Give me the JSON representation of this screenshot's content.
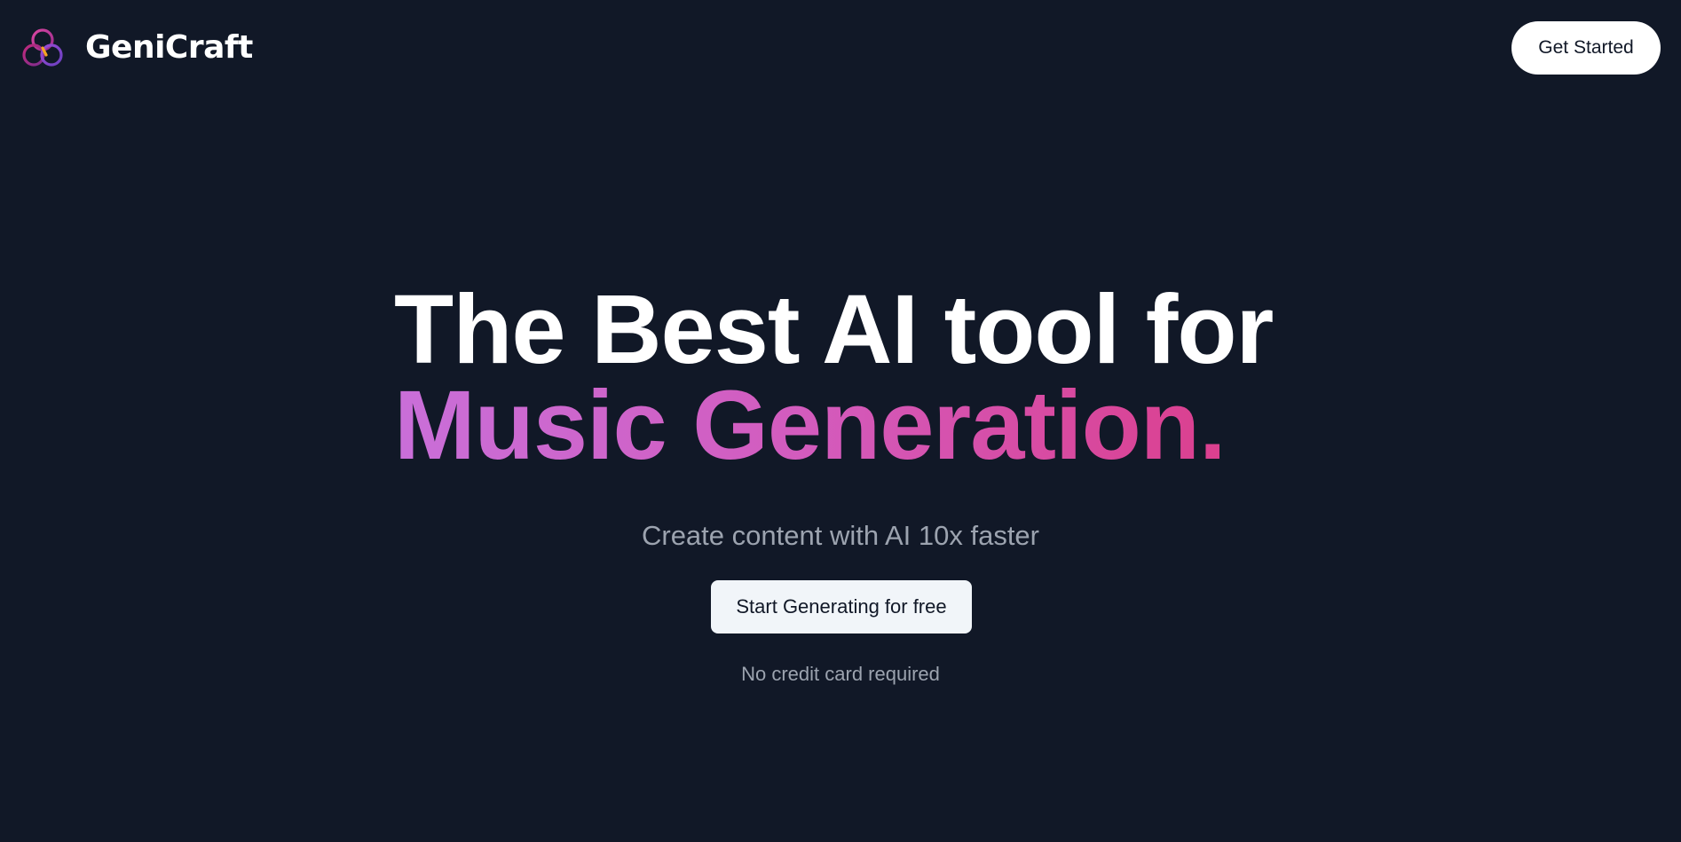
{
  "navbar": {
    "brand_name": "GeniCraft",
    "logo_icon": "triple-ring-logo-icon",
    "cta_label": "Get Started"
  },
  "hero": {
    "headline_line1": "The Best AI tool for",
    "headline_line2": "Music Generation.",
    "subtitle": "Create content with AI 10x faster",
    "cta_label": "Start Generating for free",
    "note": "No credit card required"
  },
  "colors": {
    "background": "#111827",
    "text_primary": "#ffffff",
    "text_muted": "#9ca3af",
    "gradient_start": "#c96fd9",
    "gradient_end": "#db3f8e",
    "cta_background": "#f1f5f9"
  }
}
